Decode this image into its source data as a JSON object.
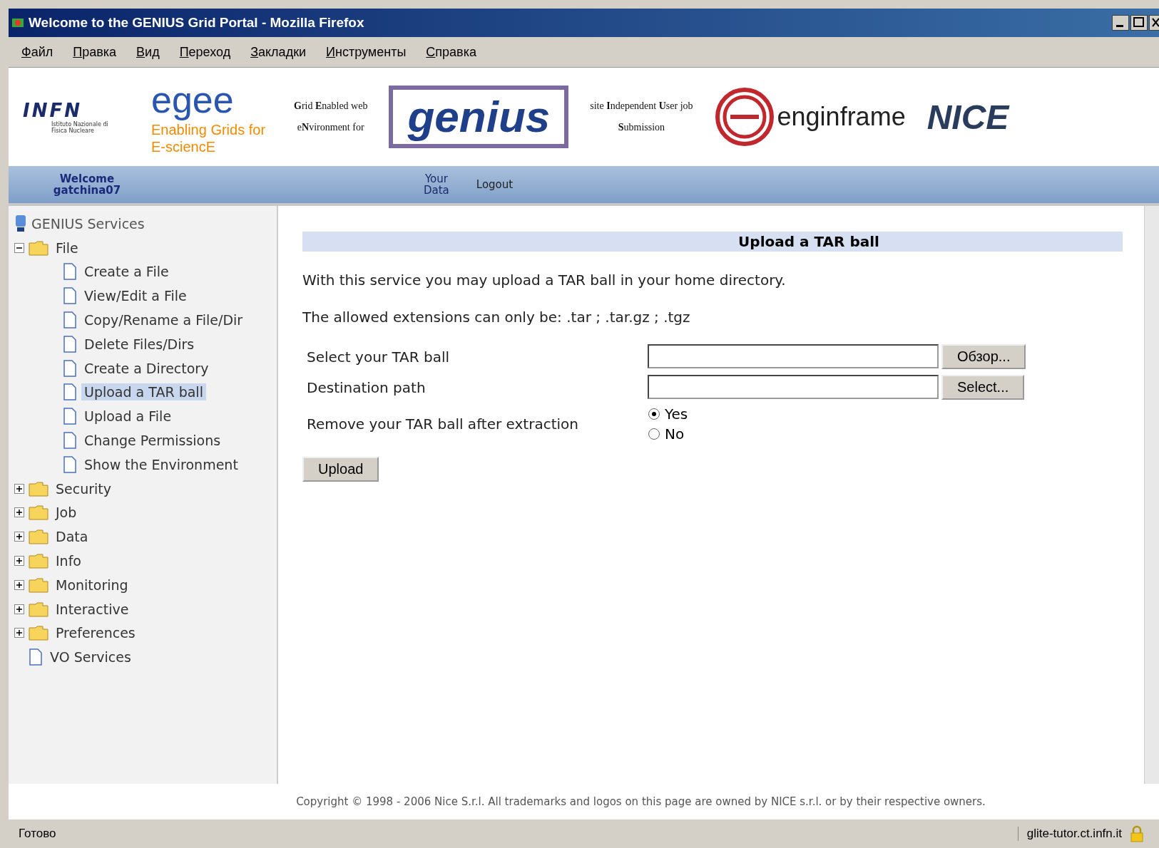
{
  "window": {
    "title": "Welcome to the GENIUS Grid Portal - Mozilla Firefox"
  },
  "menu": [
    "Файл",
    "Правка",
    "Вид",
    "Переход",
    "Закладки",
    "Инструменты",
    "Справка"
  ],
  "banner": {
    "infn": "INFN",
    "infn_sub": "Istituto Nazionale di Fisica Nucleare",
    "egee": "egee",
    "egee_sub": "Enabling Grids for E-sciencE",
    "genius_left": [
      "**G**rid **E**nabled web",
      "e**N**vironment for"
    ],
    "genius": "genius",
    "genius_right": [
      "site **I**ndependent **U**ser job",
      "**S**ubmission"
    ],
    "enginframe": "enginframe",
    "nice": "NICE"
  },
  "navbar": {
    "welcome": "Welcome",
    "user": "gatchina07",
    "links": [
      "Your Data",
      "Logout"
    ]
  },
  "sidebar": {
    "root": "GENIUS Services",
    "items": [
      {
        "kind": "folder",
        "label": "File",
        "expanded": true,
        "selected": false,
        "children": [
          {
            "kind": "page",
            "label": "Create a File",
            "selected": false
          },
          {
            "kind": "page",
            "label": "View/Edit a File",
            "selected": false
          },
          {
            "kind": "page",
            "label": "Copy/Rename a File/Dir",
            "selected": false
          },
          {
            "kind": "page",
            "label": "Delete Files/Dirs",
            "selected": false
          },
          {
            "kind": "page",
            "label": "Create a Directory",
            "selected": false
          },
          {
            "kind": "page",
            "label": "Upload a TAR ball",
            "selected": true
          },
          {
            "kind": "page",
            "label": "Upload a File",
            "selected": false
          },
          {
            "kind": "page",
            "label": "Change Permissions",
            "selected": false
          },
          {
            "kind": "page",
            "label": "Show the Environment",
            "selected": false
          }
        ]
      },
      {
        "kind": "folder",
        "label": "Security",
        "expanded": false,
        "selected": false
      },
      {
        "kind": "folder",
        "label": "Job",
        "expanded": false,
        "selected": false
      },
      {
        "kind": "folder",
        "label": "Data",
        "expanded": false,
        "selected": false
      },
      {
        "kind": "folder",
        "label": "Info",
        "expanded": false,
        "selected": false
      },
      {
        "kind": "folder",
        "label": "Monitoring",
        "expanded": false,
        "selected": false
      },
      {
        "kind": "folder",
        "label": "Interactive",
        "expanded": false,
        "selected": false
      },
      {
        "kind": "folder",
        "label": "Preferences",
        "expanded": false,
        "selected": false
      },
      {
        "kind": "page",
        "label": "VO Services",
        "selected": false
      }
    ]
  },
  "content": {
    "heading": "Upload a TAR ball",
    "paragraphs": [
      "With this service you may upload a TAR ball in your home directory.",
      "The allowed extensions can only be: .tar ; .tar.gz ; .tgz"
    ],
    "fields": [
      {
        "label": "Select your TAR ball",
        "button": "Обзор..."
      },
      {
        "label": "Destination path",
        "button": "Select..."
      }
    ],
    "remove": {
      "label": "Remove your TAR ball after extraction",
      "options": [
        {
          "label": "Yes",
          "selected": true
        },
        {
          "label": "No",
          "selected": false
        }
      ]
    },
    "submit": "Upload"
  },
  "footer": "Copyright © 1998 - 2006 Nice S.r.l. All trademarks and logos on this page are owned by NICE s.r.l. or by their respective owners.",
  "status_bar": {
    "text": "Готово",
    "host": "glite-tutor.ct.infn.it"
  }
}
